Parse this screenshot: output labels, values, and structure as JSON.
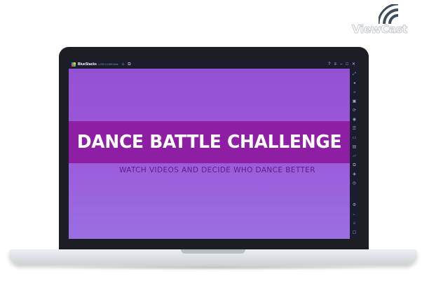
{
  "watermark": {
    "brand": "ViewCast"
  },
  "emulator": {
    "app_name": "BlueStacks",
    "version": "4.200.0.1055 Beta",
    "titlebar_left_icons": [
      "home-icon",
      "multi-instance-icon"
    ],
    "titlebar_right_icons": [
      "help-icon",
      "menu-icon",
      "minimize-icon",
      "maximize-icon",
      "close-icon"
    ],
    "sidebar_icons": [
      "fullscreen-icon",
      "volume-up-icon",
      "volume-down-icon",
      "keyboard-icon",
      "rotate-icon",
      "screenshot-icon",
      "shake-icon",
      "camera-icon",
      "macro-icon",
      "folder-icon",
      "copy-icon",
      "layers-icon",
      "location-icon",
      "settings-icon",
      "back-icon",
      "home-nav-icon",
      "recent-apps-icon"
    ]
  },
  "screen": {
    "title": "DANCE BATTLE CHALLENGE",
    "subtitle": "WATCH VIDEOS AND DECIDE WHO DANCE BETTER"
  },
  "colors": {
    "screen_bg": "#9a5ad8",
    "title_band": "#8e1fa5",
    "subtitle": "#661a82",
    "chrome": "#1a1d2e"
  }
}
